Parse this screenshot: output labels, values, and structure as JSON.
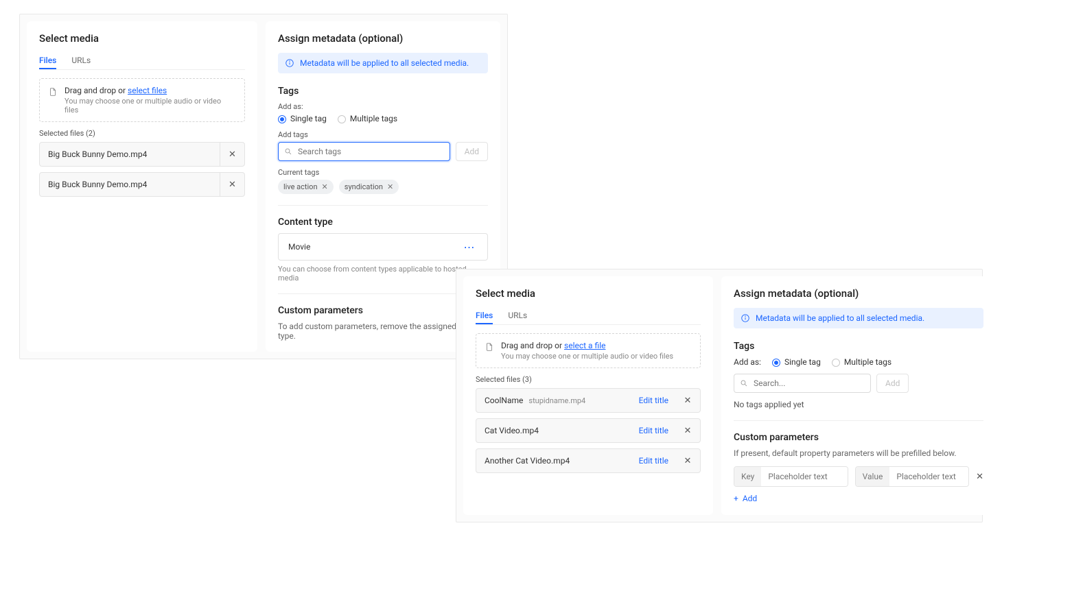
{
  "dialogA": {
    "selectMedia": {
      "title": "Select media",
      "tabs": {
        "files": "Files",
        "urls": "URLs"
      },
      "dropzone": {
        "text": "Drag and drop or ",
        "link": "select files",
        "hint": "You may choose one or multiple audio or video files"
      },
      "selectedHeader": "Selected files (2)",
      "files": [
        {
          "name": "Big Buck Bunny Demo.mp4"
        },
        {
          "name": "Big Buck Bunny Demo.mp4"
        }
      ]
    },
    "assign": {
      "title": "Assign metadata (optional)",
      "banner": "Metadata will be applied to all selected media.",
      "tags": {
        "header": "Tags",
        "addAsLabel": "Add as:",
        "single": "Single tag",
        "multiple": "Multiple tags",
        "addTagsLabel": "Add tags",
        "searchPlaceholder": "Search tags",
        "addBtn": "Add",
        "currentLabel": "Current tags",
        "chips": [
          "live action",
          "syndication"
        ]
      },
      "contentType": {
        "header": "Content type",
        "value": "Movie",
        "help": "You can choose from content types applicable to hosted media"
      },
      "custom": {
        "header": "Custom parameters",
        "desc": "To add custom parameters, remove the assigned content type."
      }
    }
  },
  "dialogB": {
    "selectMedia": {
      "title": "Select media",
      "tabs": {
        "files": "Files",
        "urls": "URLs"
      },
      "dropzone": {
        "text": "Drag and drop or ",
        "link": "select a file",
        "hint": "You may choose one or multiple audio or video files"
      },
      "selectedHeader": "Selected files (3)",
      "editLabel": "Edit title",
      "files": [
        {
          "name": "CoolName",
          "sub": "stupidname.mp4"
        },
        {
          "name": "Cat Video.mp4"
        },
        {
          "name": "Another Cat Video.mp4"
        }
      ]
    },
    "assign": {
      "title": "Assign metadata (optional)",
      "banner": "Metadata will be applied to all selected media.",
      "tags": {
        "header": "Tags",
        "addAsLabel": "Add as:",
        "single": "Single tag",
        "multiple": "Multiple tags",
        "searchPlaceholder": "Search...",
        "addBtn": "Add",
        "emptyMsg": "No tags applied yet"
      },
      "custom": {
        "header": "Custom parameters",
        "desc": "If present, default property parameters will be prefilled below.",
        "keyLabel": "Key",
        "valueLabel": "Value",
        "placeholder": "Placeholder text",
        "addLink": "Add"
      }
    }
  }
}
